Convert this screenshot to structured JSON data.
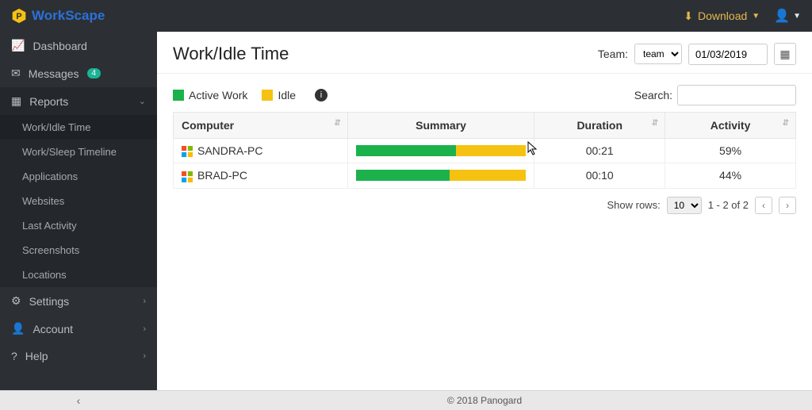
{
  "brand": "WorkScape",
  "topbar": {
    "download_label": "Download"
  },
  "sidebar": {
    "dashboard": "Dashboard",
    "messages": "Messages",
    "messages_badge": "4",
    "reports": "Reports",
    "report_items": {
      "work_idle": "Work/Idle Time",
      "work_sleep": "Work/Sleep Timeline",
      "applications": "Applications",
      "websites": "Websites",
      "last_activity": "Last Activity",
      "screenshots": "Screenshots",
      "locations": "Locations"
    },
    "settings": "Settings",
    "account": "Account",
    "help": "Help"
  },
  "page": {
    "title": "Work/Idle Time",
    "team_label": "Team:",
    "team_value": "team",
    "date_value": "01/03/2019"
  },
  "legend": {
    "active": "Active Work",
    "idle": "Idle",
    "search_label": "Search:"
  },
  "table": {
    "headers": {
      "computer": "Computer",
      "summary": "Summary",
      "duration": "Duration",
      "activity": "Activity"
    },
    "rows": [
      {
        "computer": "SANDRA-PC",
        "active_pct": 59,
        "duration": "00:21",
        "activity": "59%"
      },
      {
        "computer": "BRAD-PC",
        "active_pct": 55,
        "duration": "00:10",
        "activity": "44%"
      }
    ]
  },
  "pager": {
    "show_rows_label": "Show rows:",
    "rows_value": "10",
    "range_text": "1 - 2 of 2"
  },
  "footer": {
    "collapse": "‹",
    "copyright": "© 2018 Panogard"
  },
  "chart_data": {
    "type": "bar",
    "title": "Work/Idle Time",
    "categories": [
      "SANDRA-PC",
      "BRAD-PC"
    ],
    "series": [
      {
        "name": "Active Work",
        "values": [
          59,
          55
        ],
        "color": "#1bb24c"
      },
      {
        "name": "Idle",
        "values": [
          41,
          45
        ],
        "color": "#f5c211"
      }
    ],
    "xlabel": "",
    "ylabel": "",
    "ylim": [
      0,
      100
    ]
  }
}
